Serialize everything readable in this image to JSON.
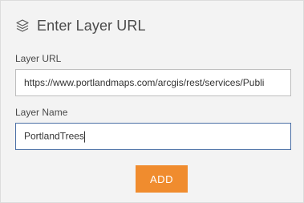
{
  "header": {
    "icon": "layers-icon",
    "title": "Enter Layer URL"
  },
  "form": {
    "url_label": "Layer URL",
    "url_value": "https://www.portlandmaps.com/arcgis/rest/services/Publi",
    "name_label": "Layer Name",
    "name_value": "PortlandTrees"
  },
  "actions": {
    "add_label": "ADD"
  },
  "colors": {
    "accent": "#f08c2e",
    "panel_bg": "#f3f3f3",
    "focus_border": "#4a6fa5"
  }
}
